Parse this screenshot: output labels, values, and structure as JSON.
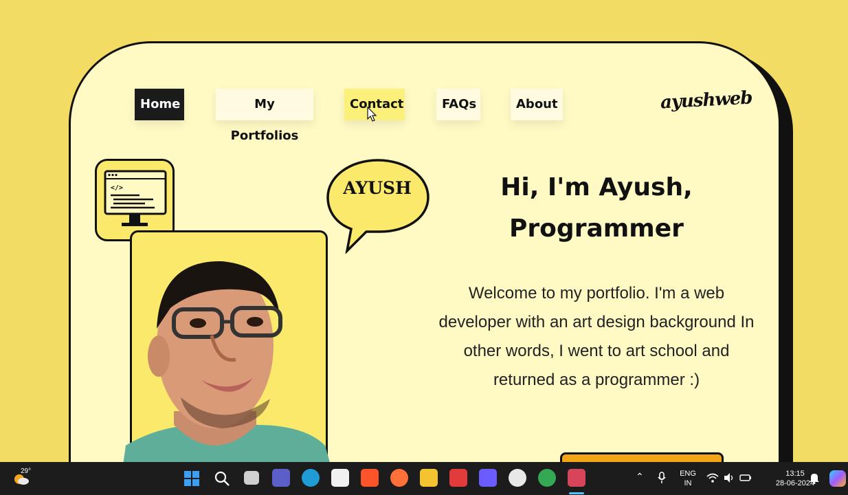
{
  "nav": {
    "items": [
      {
        "label": "Home"
      },
      {
        "label": "My Portfolios"
      },
      {
        "label": "Contact"
      },
      {
        "label": "FAQs"
      },
      {
        "label": "About"
      }
    ],
    "active": "Home",
    "hovered": "Contact"
  },
  "logo": {
    "text": "ayushweb"
  },
  "illustration": {
    "bubble_text": "AYUSH",
    "monitor_icon": "code-monitor-icon"
  },
  "hero": {
    "title_line1": "Hi, I'm Ayush,",
    "title_line2": "Programmer",
    "intro": "Welcome to my portfolio. I'm a web developer with an art design background In other words, I went to art school and returned as a programmer :)"
  },
  "taskbar": {
    "weather_temp": "29°",
    "language_top": "ENG",
    "language_bottom": "IN",
    "time": "13:15",
    "date": "28-06-2024",
    "apps": [
      "start-icon",
      "search-icon",
      "task-view-icon",
      "teams-icon",
      "edge-icon",
      "store-icon",
      "brave-icon",
      "firefox-icon",
      "file-explorer-icon",
      "wps-icon",
      "media-icon",
      "chatgpt-icon",
      "chrome-icon",
      "snipping-tool-icon"
    ]
  },
  "colors": {
    "background": "#f2dc63",
    "card": "#fff9c4",
    "accent_yellow": "#fbe96b",
    "cta_orange": "#f2a516",
    "nav_active": "#1b1b1b"
  }
}
